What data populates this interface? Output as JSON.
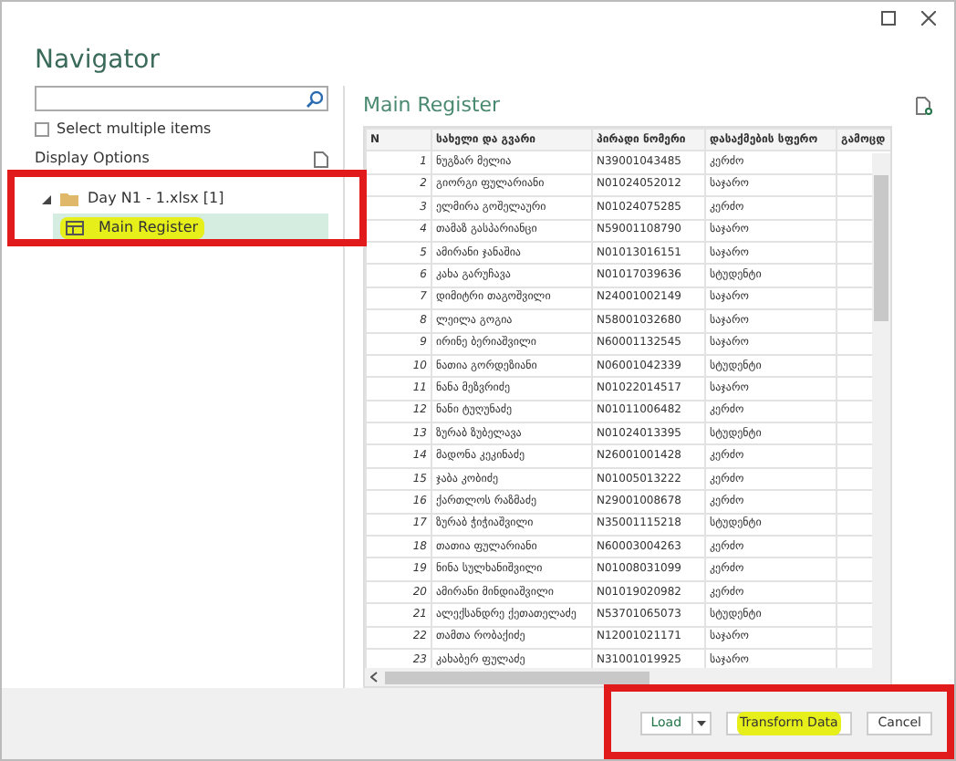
{
  "window": {
    "title": "Navigator"
  },
  "select_multiple": {
    "label": "Select multiple items",
    "checked": false
  },
  "display_options": {
    "label": "Display Options"
  },
  "tree": [
    {
      "label": "Day N1 - 1.xlsx [1]",
      "expanded": true,
      "children": [
        {
          "label": "Main Register",
          "selected": true,
          "highlighted": true
        }
      ]
    }
  ],
  "preview": {
    "title": "Main Register",
    "table": {
      "columns": [
        "N",
        "სახელი და გვარი",
        "პირადი ნომერი",
        "დასაქმების სფერო",
        "გამოცდ"
      ],
      "rows": [
        [
          "1",
          "ნუგზარ მელია",
          "N39001043485",
          "კერძო"
        ],
        [
          "2",
          "გიორგი ფულარიანი",
          "N01024052012",
          "საჯარო"
        ],
        [
          "3",
          "ელმირა გოშელაური",
          "N01024075285",
          "კერძო"
        ],
        [
          "4",
          "თამაზ გასპარიანცი",
          "N59001108790",
          "საჯარო"
        ],
        [
          "5",
          "ამირანი ჯანაშია",
          "N01013016151",
          "საჯარო"
        ],
        [
          "6",
          "კახა გარუჩავა",
          "N01017039636",
          "სტუდენტი"
        ],
        [
          "7",
          "დიმიტრი თაგოშვილი",
          "N24001002149",
          "საჯარო"
        ],
        [
          "8",
          "ლეილა გოგია",
          "N58001032680",
          "საჯარო"
        ],
        [
          "9",
          "ირინე ბერიაშვილი",
          "N60001132545",
          "საჯარო"
        ],
        [
          "10",
          "ნათია გორდეზიანი",
          "N06001042339",
          "სტუდენტი"
        ],
        [
          "11",
          "ნანა მეზვრიძე",
          "N01022014517",
          "საჯარო"
        ],
        [
          "12",
          "ნანი ტუღუნაძე",
          "N01011006482",
          "კერძო"
        ],
        [
          "13",
          "ზურაბ ზუბელავა",
          "N01024013395",
          "სტუდენტი"
        ],
        [
          "14",
          "მადონა კეკინაძე",
          "N26001001428",
          "კერძო"
        ],
        [
          "15",
          "ჯაბა კობიძე",
          "N01005013222",
          "კერძო"
        ],
        [
          "16",
          "ქართლოს რაზმაძე",
          "N29001008678",
          "კერძო"
        ],
        [
          "17",
          "ზურაბ ჭიჭიაშვილი",
          "N35001115218",
          "სტუდენტი"
        ],
        [
          "18",
          "თათია ფულარიანი",
          "N60003004263",
          "კერძო"
        ],
        [
          "19",
          "ნინა სულხანიშვილი",
          "N01008031099",
          "კერძო"
        ],
        [
          "20",
          "ამირანი მინდიაშვილი",
          "N01019020982",
          "კერძო"
        ],
        [
          "21",
          "ალექსანდრე ქეთათელაძე",
          "N53701065073",
          "სტუდენტი"
        ],
        [
          "22",
          "თამთა რობაქიძე",
          "N12001021171",
          "საჯარო"
        ],
        [
          "23",
          "კახაბერ ფულაძე",
          "N31001019925",
          "საჯარო"
        ]
      ]
    }
  },
  "buttons": [
    {
      "label": "Load",
      "kind": "split",
      "highlighted": false
    },
    {
      "label": "Transform Data",
      "kind": "plain",
      "highlighted": true
    },
    {
      "label": "Cancel",
      "kind": "plain",
      "highlighted": false
    }
  ]
}
